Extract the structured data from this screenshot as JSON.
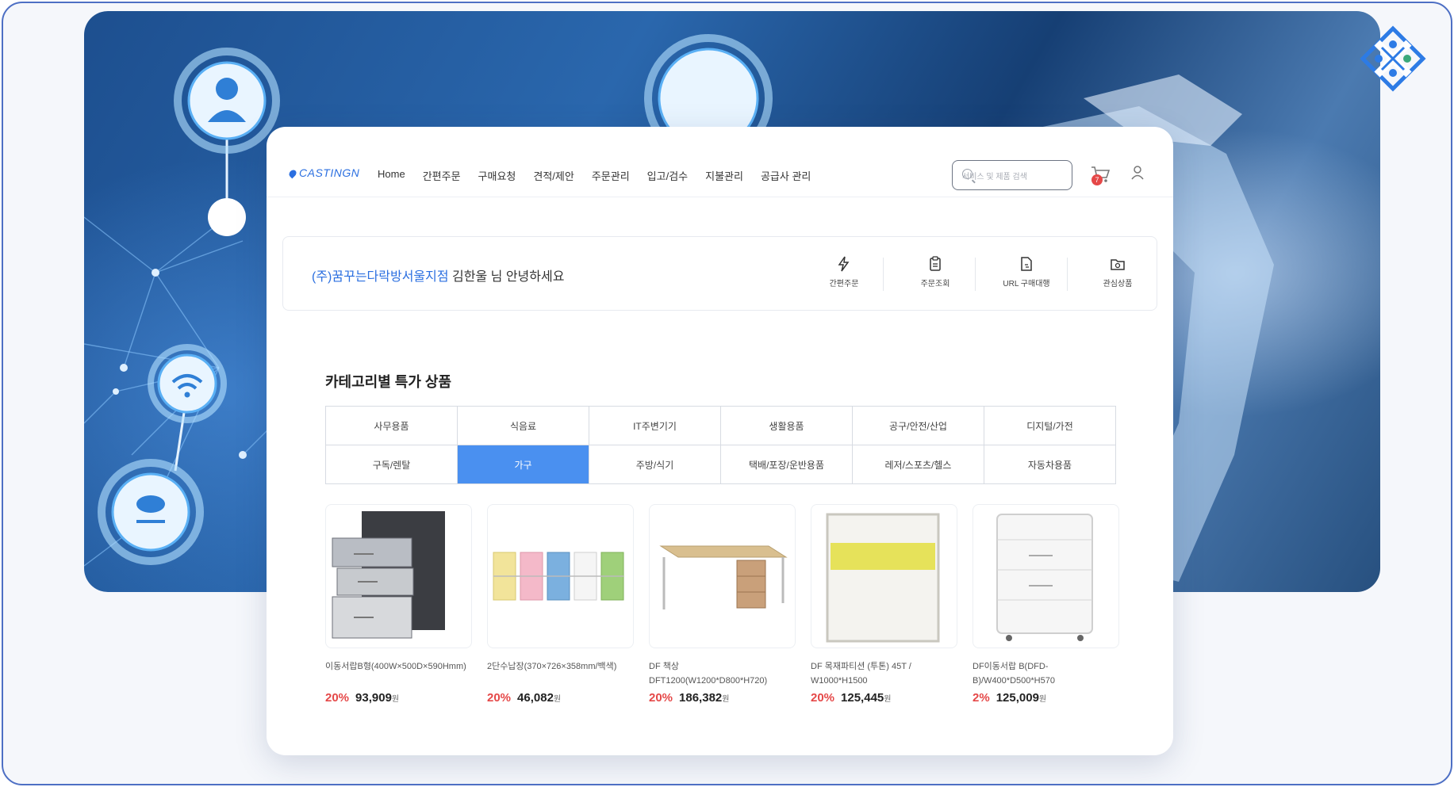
{
  "nav": {
    "brand": "CASTINGN",
    "menu": [
      "Home",
      "간편주문",
      "구매요청",
      "견적/제안",
      "주문관리",
      "입고/검수",
      "지불관리",
      "공급사 관리"
    ],
    "search_placeholder": "서비스 및 제품 검색",
    "cart_count": "7"
  },
  "welcome": {
    "company": "(주)꿈꾸는다락방서울지점",
    "name": "김한울",
    "suffix": "님 안녕하세요",
    "quick": [
      {
        "label": "간편주문",
        "icon": "lightning-icon"
      },
      {
        "label": "주문조회",
        "icon": "clipboard-icon"
      },
      {
        "label": "URL 구매대행",
        "icon": "document-link-icon"
      },
      {
        "label": "관심상품",
        "icon": "folder-heart-icon"
      }
    ]
  },
  "section_title": "카테고리별 특가 상품",
  "categories": [
    "사무용품",
    "식음료",
    "IT주변기기",
    "생활용품",
    "공구/안전/산업",
    "디지털/가전",
    "구독/렌탈",
    "가구",
    "주방/식기",
    "택배/포장/운반용품",
    "레저/스포츠/헬스",
    "자동차용품"
  ],
  "active_category": "가구",
  "products": [
    {
      "name": "이동서랍B형(400W×500D×590Hmm)",
      "discount": "20%",
      "price": "93,909",
      "unit": "원"
    },
    {
      "name": "2단수납장(370×726×358mm/백색)",
      "discount": "20%",
      "price": "46,082",
      "unit": "원"
    },
    {
      "name": "DF 책상 DFT1200(W1200*D800*H720)",
      "discount": "20%",
      "price": "186,382",
      "unit": "원"
    },
    {
      "name": "DF 목재파티션 (투톤) 45T / W1000*H1500",
      "discount": "20%",
      "price": "125,445",
      "unit": "원"
    },
    {
      "name": "DF이동서랍 B(DFD-B)/W400*D500*H570",
      "discount": "2%",
      "price": "125,009",
      "unit": "원"
    }
  ],
  "colors": {
    "accent": "#2b6fe0",
    "active_tab": "#4a90f0",
    "discount": "#e54848",
    "frame": "#4d6fc4"
  }
}
